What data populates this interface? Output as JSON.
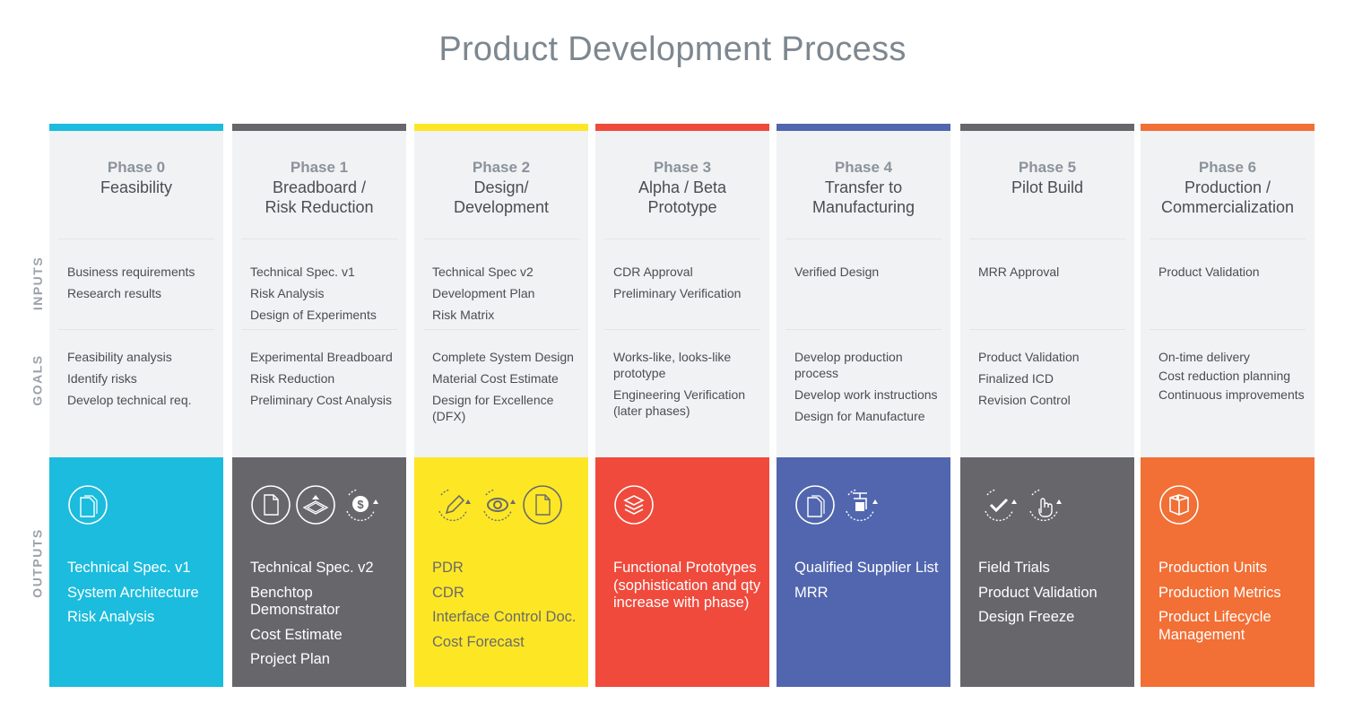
{
  "title": "Product Development Process",
  "row_labels": {
    "inputs": "INPUTS",
    "goals": "GOALS",
    "outputs": "OUTPUTS"
  },
  "phases": [
    {
      "number": "Phase 0",
      "name": "Feasibility",
      "color": "#1bbcdd",
      "text_color": "#ffffff",
      "inputs": [
        "Business requirements",
        "Research results"
      ],
      "goals": [
        "Feasibility analysis",
        "Identify risks",
        "Develop technical req."
      ],
      "output_icons": [
        "documents-icon"
      ],
      "outputs": [
        "Technical Spec. v1",
        "System Architecture",
        "Risk Analysis"
      ]
    },
    {
      "number": "Phase 1",
      "name": "Breadboard /\nRisk Reduction",
      "color": "#67666b",
      "text_color": "#ffffff",
      "inputs": [
        "Technical Spec. v1",
        "Risk Analysis",
        "Design of Experiments"
      ],
      "goals": [
        "Experimental Breadboard",
        "Risk Reduction",
        "Preliminary Cost Analysis"
      ],
      "output_icons": [
        "document-icon",
        "layers-icon",
        "dollar-cycle-icon"
      ],
      "outputs": [
        "Technical Spec. v2",
        "Benchtop Demonstrator",
        "Cost Estimate",
        "Project Plan"
      ]
    },
    {
      "number": "Phase 2",
      "name": "Design/\nDevelopment",
      "color": "#fde725",
      "text_color": "#6b6b6b",
      "inputs": [
        "Technical Spec v2",
        "Development Plan",
        "Risk Matrix"
      ],
      "goals": [
        "Complete System Design",
        "Material Cost Estimate",
        "Design for Excellence (DFX)"
      ],
      "output_icons": [
        "pencil-cycle-icon",
        "eye-cycle-icon",
        "document-icon"
      ],
      "outputs": [
        "PDR",
        "CDR",
        "Interface Control Doc.",
        "Cost Forecast"
      ]
    },
    {
      "number": "Phase 3",
      "name": "Alpha / Beta\nPrototype",
      "color": "#ef4a3c",
      "text_color": "#ffffff",
      "inputs": [
        "CDR Approval",
        "Preliminary Verification"
      ],
      "goals": [
        "Works-like, looks-like prototype",
        "Engineering Verification (later phases)"
      ],
      "output_icons": [
        "stack-icon"
      ],
      "outputs": [
        "Functional Prototypes (sophistication and qty increase with phase)"
      ]
    },
    {
      "number": "Phase 4",
      "name": "Transfer to\nManufacturing",
      "color": "#5166ae",
      "text_color": "#ffffff",
      "inputs": [
        "Verified Design"
      ],
      "goals": [
        "Develop production process",
        "Develop work instructions",
        "Design for Manufacture"
      ],
      "output_icons": [
        "documents-icon",
        "transfer-cycle-icon"
      ],
      "outputs": [
        "Qualified Supplier List",
        "MRR"
      ]
    },
    {
      "number": "Phase 5",
      "name": "Pilot Build",
      "color": "#67666b",
      "text_color": "#ffffff",
      "inputs": [
        "MRR Approval"
      ],
      "goals": [
        "Product Validation",
        "Finalized ICD",
        "Revision Control"
      ],
      "output_icons": [
        "check-cycle-icon",
        "touch-cycle-icon"
      ],
      "outputs": [
        "Field Trials",
        "Product Validation",
        "Design Freeze"
      ]
    },
    {
      "number": "Phase 6",
      "name": "Production /\nCommercialization",
      "color": "#f26f35",
      "text_color": "#ffffff",
      "inputs": [
        "Product Validation"
      ],
      "goals": [
        "On-time delivery",
        "Cost reduction planning",
        "Continuous improvements"
      ],
      "output_icons": [
        "box-icon"
      ],
      "outputs": [
        "Production Units",
        "Production Metrics",
        "Product Lifecycle Management"
      ]
    }
  ]
}
